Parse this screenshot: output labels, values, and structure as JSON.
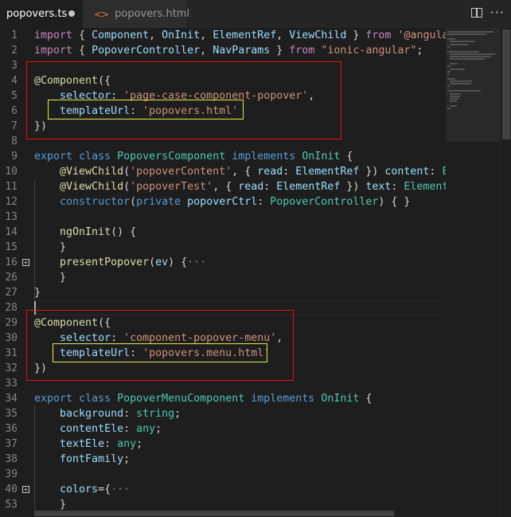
{
  "tabs": [
    {
      "label": "popovers.ts",
      "active": true,
      "modified": true
    },
    {
      "label": "popovers.html",
      "active": false,
      "icon_text": "<>"
    }
  ],
  "toolbar": {
    "split_icon": "split-editor-icon",
    "more_icon": "more-actions-icon",
    "more_label": "···"
  },
  "colors": {
    "editor_bg": "#1e1e1e",
    "annotation_red": "#e51400",
    "annotation_yellow": "#e6e651"
  },
  "code": [
    {
      "n": "1",
      "tokens": [
        [
          "k",
          "import"
        ],
        [
          "p",
          " { "
        ],
        [
          "v",
          "Component"
        ],
        [
          "p",
          ", "
        ],
        [
          "v",
          "OnInit"
        ],
        [
          "p",
          ", "
        ],
        [
          "v",
          "ElementRef"
        ],
        [
          "p",
          ", "
        ],
        [
          "v",
          "ViewChild"
        ],
        [
          "p",
          " } "
        ],
        [
          "k",
          "from"
        ],
        [
          "p",
          " "
        ],
        [
          "s",
          "'@angular/core';"
        ]
      ]
    },
    {
      "n": "2",
      "tokens": [
        [
          "k",
          "import"
        ],
        [
          "p",
          " { "
        ],
        [
          "v",
          "PopoverController"
        ],
        [
          "p",
          ", "
        ],
        [
          "v",
          "NavParams"
        ],
        [
          "p",
          " } "
        ],
        [
          "k",
          "from"
        ],
        [
          "p",
          " "
        ],
        [
          "s",
          "\"ionic-angular\""
        ],
        [
          "p",
          ";"
        ]
      ]
    },
    {
      "n": "3",
      "tokens": []
    },
    {
      "n": "4",
      "tokens": [
        [
          "f",
          "@Component"
        ],
        [
          "p",
          "({"
        ]
      ]
    },
    {
      "n": "5",
      "tokens": [
        [
          "p",
          "    "
        ],
        [
          "v",
          "selector"
        ],
        [
          "p",
          ": "
        ],
        [
          "s",
          "'page-case-component-popover'"
        ],
        [
          "p",
          ","
        ]
      ]
    },
    {
      "n": "6",
      "tokens": [
        [
          "p",
          "    "
        ],
        [
          "v",
          "templateUrl"
        ],
        [
          "p",
          ": "
        ],
        [
          "s",
          "'popovers.html'"
        ]
      ]
    },
    {
      "n": "7",
      "tokens": [
        [
          "p",
          "})"
        ]
      ]
    },
    {
      "n": "8",
      "tokens": []
    },
    {
      "n": "9",
      "tokens": [
        [
          "b",
          "export"
        ],
        [
          "p",
          " "
        ],
        [
          "b",
          "class"
        ],
        [
          "p",
          " "
        ],
        [
          "t",
          "PopoversComponent"
        ],
        [
          "p",
          " "
        ],
        [
          "b",
          "implements"
        ],
        [
          "p",
          " "
        ],
        [
          "t",
          "OnInit"
        ],
        [
          "p",
          " {"
        ]
      ]
    },
    {
      "n": "10",
      "tokens": [
        [
          "p",
          "    "
        ],
        [
          "f",
          "@ViewChild"
        ],
        [
          "p",
          "("
        ],
        [
          "s",
          "'popoverContent'"
        ],
        [
          "p",
          ", { "
        ],
        [
          "v",
          "read"
        ],
        [
          "p",
          ": "
        ],
        [
          "v",
          "ElementRef"
        ],
        [
          "p",
          " }) "
        ],
        [
          "v",
          "content"
        ],
        [
          "p",
          ": "
        ],
        [
          "t",
          "ElementRef"
        ],
        [
          "p",
          ";"
        ]
      ]
    },
    {
      "n": "11",
      "tokens": [
        [
          "p",
          "    "
        ],
        [
          "f",
          "@ViewChild"
        ],
        [
          "p",
          "("
        ],
        [
          "s",
          "'popoverTest'"
        ],
        [
          "p",
          ", { "
        ],
        [
          "v",
          "read"
        ],
        [
          "p",
          ": "
        ],
        [
          "v",
          "ElementRef"
        ],
        [
          "p",
          " }) "
        ],
        [
          "v",
          "text"
        ],
        [
          "p",
          ": "
        ],
        [
          "t",
          "ElementRef"
        ],
        [
          "p",
          ";"
        ]
      ]
    },
    {
      "n": "12",
      "tokens": [
        [
          "p",
          "    "
        ],
        [
          "b",
          "constructor"
        ],
        [
          "p",
          "("
        ],
        [
          "b",
          "private"
        ],
        [
          "p",
          " "
        ],
        [
          "v",
          "popoverCtrl"
        ],
        [
          "p",
          ": "
        ],
        [
          "t",
          "PopoverController"
        ],
        [
          "p",
          ") { }"
        ]
      ]
    },
    {
      "n": "13",
      "tokens": []
    },
    {
      "n": "14",
      "tokens": [
        [
          "p",
          "    "
        ],
        [
          "f",
          "ngOnInit"
        ],
        [
          "p",
          "() {"
        ]
      ]
    },
    {
      "n": "15",
      "tokens": [
        [
          "p",
          "    }"
        ]
      ]
    },
    {
      "n": "16",
      "tokens": [
        [
          "p",
          "    "
        ],
        [
          "f",
          "presentPopover"
        ],
        [
          "p",
          "("
        ],
        [
          "v",
          "ev"
        ],
        [
          "p",
          ") {"
        ],
        [
          "e",
          "···"
        ]
      ],
      "folded": true
    },
    {
      "n": "26",
      "tokens": [
        [
          "p",
          "    }"
        ]
      ]
    },
    {
      "n": "27",
      "tokens": [
        [
          "p",
          "}"
        ]
      ]
    },
    {
      "n": "28",
      "tokens": [],
      "cursor": true
    },
    {
      "n": "29",
      "tokens": [
        [
          "f",
          "@Component"
        ],
        [
          "p",
          "({"
        ]
      ]
    },
    {
      "n": "30",
      "tokens": [
        [
          "p",
          "    "
        ],
        [
          "v",
          "selector"
        ],
        [
          "p",
          ": "
        ],
        [
          "s",
          "'component-popover-menu'"
        ],
        [
          "p",
          ","
        ]
      ]
    },
    {
      "n": "31",
      "tokens": [
        [
          "p",
          "    "
        ],
        [
          "v",
          "templateUrl"
        ],
        [
          "p",
          ": "
        ],
        [
          "s",
          "'popovers.menu.html'"
        ]
      ]
    },
    {
      "n": "32",
      "tokens": [
        [
          "p",
          "})"
        ]
      ]
    },
    {
      "n": "33",
      "tokens": []
    },
    {
      "n": "34",
      "tokens": [
        [
          "b",
          "export"
        ],
        [
          "p",
          " "
        ],
        [
          "b",
          "class"
        ],
        [
          "p",
          " "
        ],
        [
          "t",
          "PopoverMenuComponent"
        ],
        [
          "p",
          " "
        ],
        [
          "b",
          "implements"
        ],
        [
          "p",
          " "
        ],
        [
          "t",
          "OnInit"
        ],
        [
          "p",
          " {"
        ]
      ]
    },
    {
      "n": "35",
      "tokens": [
        [
          "p",
          "    "
        ],
        [
          "v",
          "background"
        ],
        [
          "p",
          ": "
        ],
        [
          "t",
          "string"
        ],
        [
          "p",
          ";"
        ]
      ]
    },
    {
      "n": "36",
      "tokens": [
        [
          "p",
          "    "
        ],
        [
          "v",
          "contentEle"
        ],
        [
          "p",
          ": "
        ],
        [
          "t",
          "any"
        ],
        [
          "p",
          ";"
        ]
      ]
    },
    {
      "n": "37",
      "tokens": [
        [
          "p",
          "    "
        ],
        [
          "v",
          "textEle"
        ],
        [
          "p",
          ": "
        ],
        [
          "t",
          "any"
        ],
        [
          "p",
          ";"
        ]
      ]
    },
    {
      "n": "38",
      "tokens": [
        [
          "p",
          "    "
        ],
        [
          "v",
          "fontFamily"
        ],
        [
          "p",
          ";"
        ]
      ]
    },
    {
      "n": "39",
      "tokens": []
    },
    {
      "n": "40",
      "tokens": [
        [
          "p",
          "    "
        ],
        [
          "v",
          "colors"
        ],
        [
          "p",
          "={"
        ],
        [
          "e",
          "···"
        ]
      ],
      "folded": true
    },
    {
      "n": "53",
      "tokens": [
        [
          "p",
          "    }"
        ]
      ]
    }
  ]
}
